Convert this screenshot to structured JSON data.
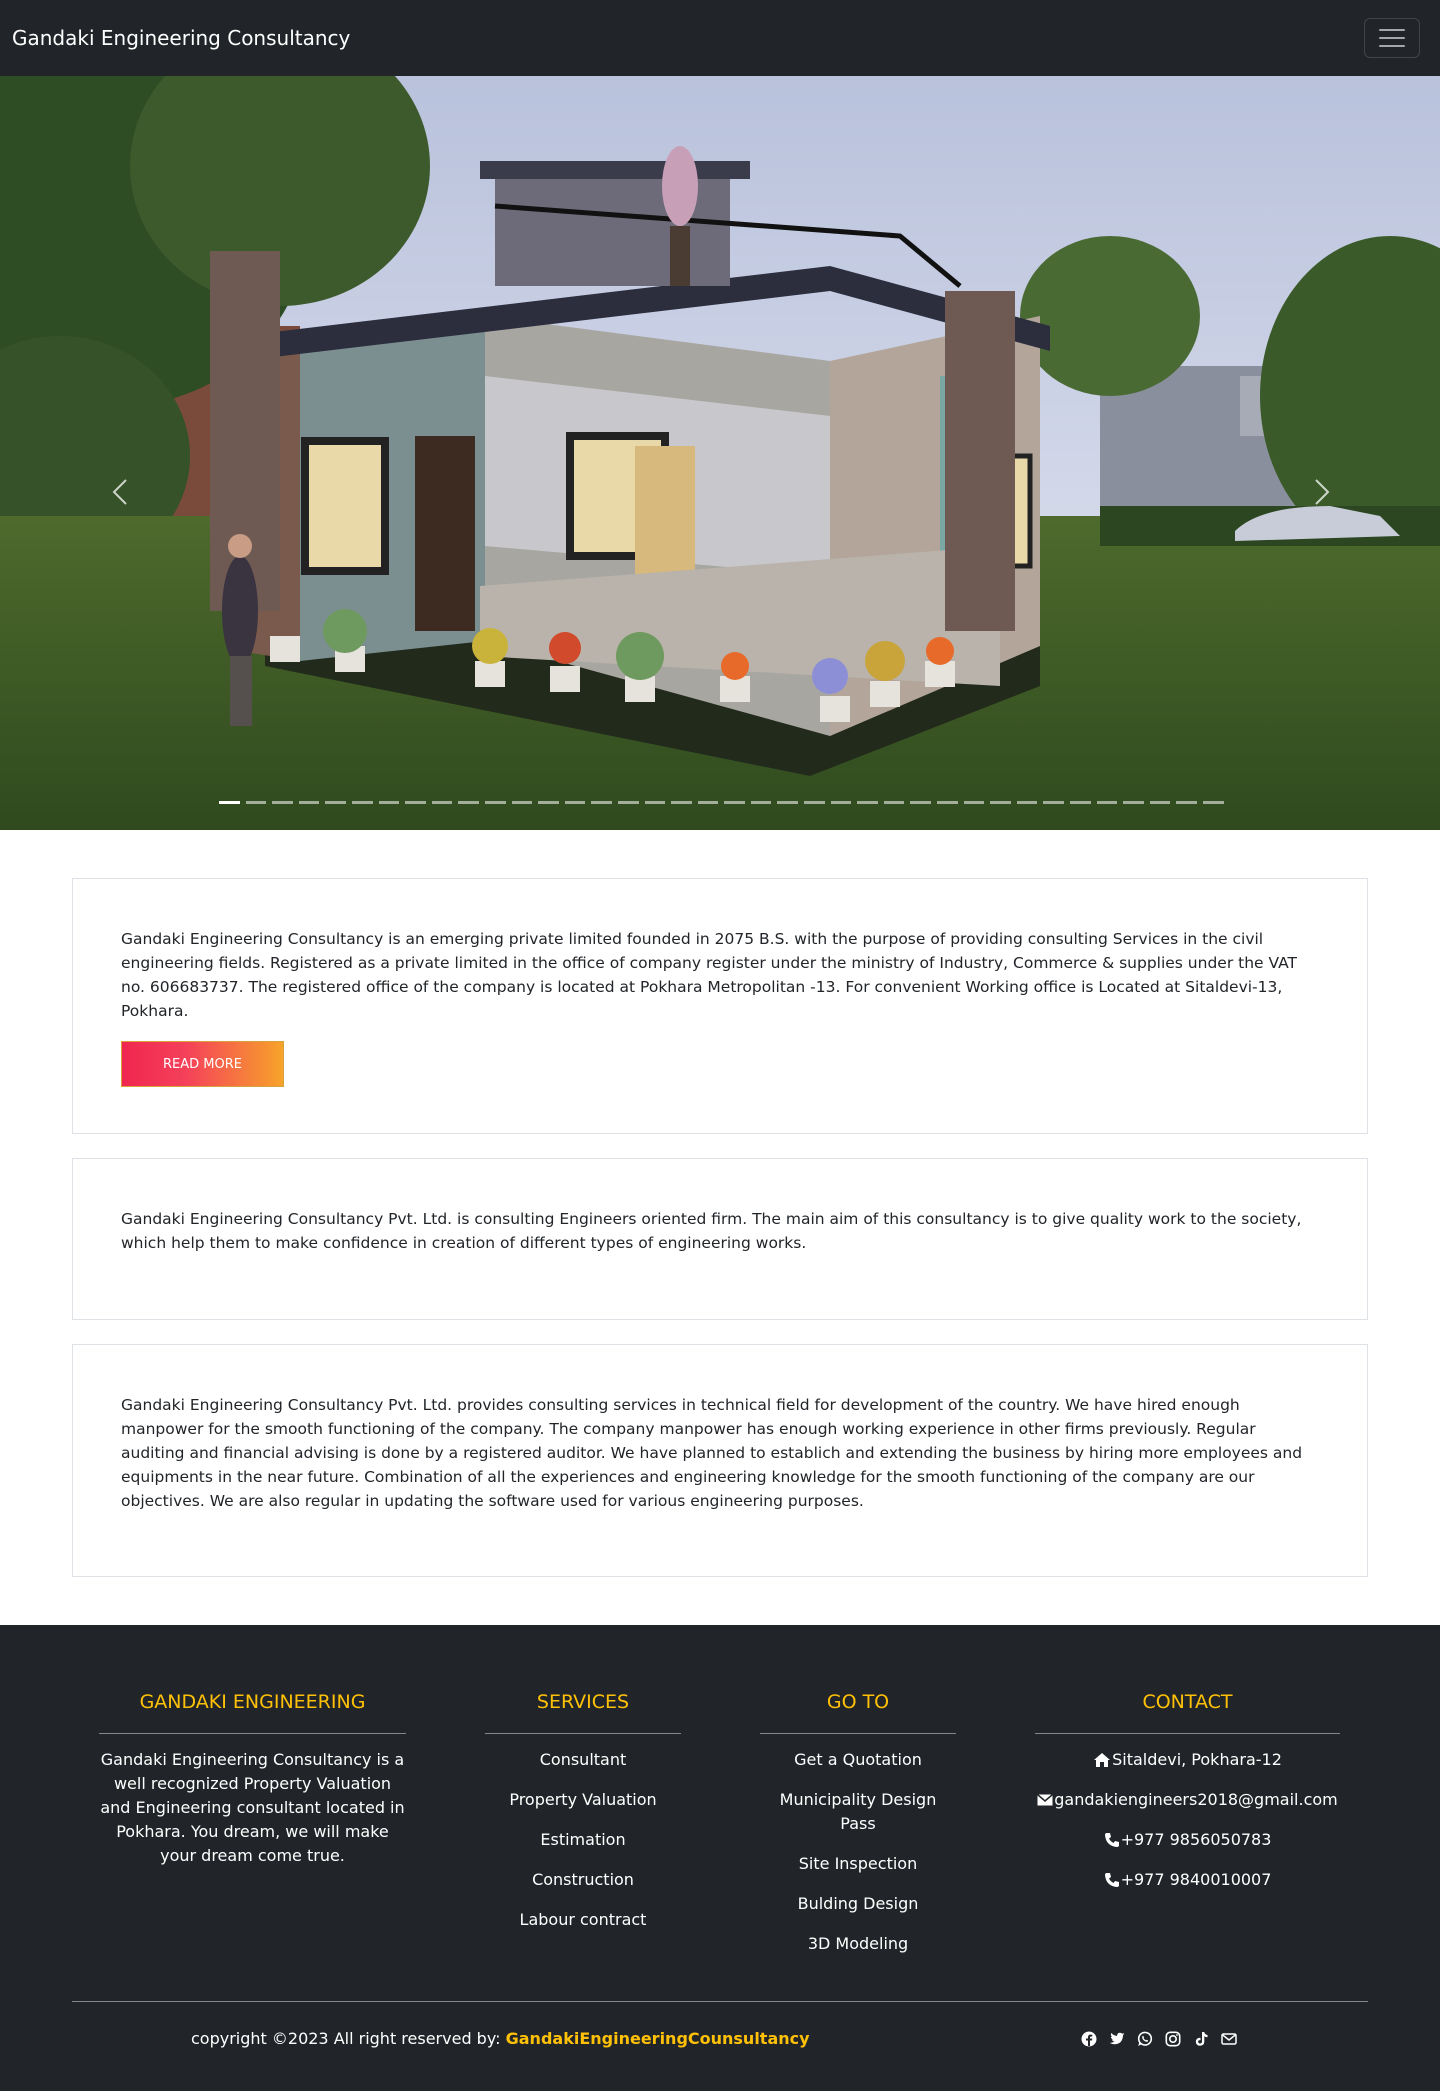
{
  "navbar": {
    "brand": "Gandaki Engineering Consultancy",
    "toggle_icon": "hamburger-menu-icon"
  },
  "carousel": {
    "slide_count": 38,
    "active_index": 0,
    "prev_icon": "chevron-left-icon",
    "next_icon": "chevron-right-icon"
  },
  "cards": [
    {
      "text": "Gandaki Engineering Consultancy is an emerging private limited founded in 2075 B.S. with the purpose of providing consulting Services in the civil engineering fields. Registered as a private limited in the office of company register under the ministry of Industry, Commerce & supplies under the VAT no. 606683737. The registered office of the company is located at Pokhara Metropolitan -13. For convenient Working office is Located at Sitaldevi-13, Pokhara.",
      "button": "READ MORE"
    },
    {
      "text": "Gandaki Engineering Consultancy Pvt. Ltd. is consulting Engineers oriented firm. The main aim of this consultancy is to give quality work to the society, which help them to make confidence in creation of different types of engineering works."
    },
    {
      "text": "Gandaki Engineering Consultancy Pvt. Ltd. provides consulting services in technical field for development of the country. We have hired enough manpower for the smooth functioning of the company. The company manpower has enough working experience in other firms previously. Regular auditing and financial advising is done by a registered auditor. We have planned to establich and extending the business by hiring more employees and equipments in the near future. Combination of all the experiences and engineering knowledge for the smooth functioning of the company are our objectives. We are also regular in updating the software used for various engineering purposes."
    }
  ],
  "footer": {
    "about": {
      "title": "GANDAKI ENGINEERING",
      "text": "Gandaki Engineering Consultancy is a well recognized Property Valuation and Engineering consultant located in Pokhara. You dream, we will make your dream come true."
    },
    "services": {
      "title": "SERVICES",
      "items": [
        "Consultant",
        "Property Valuation",
        "Estimation",
        "Construction",
        "Labour contract"
      ]
    },
    "goto": {
      "title": "GO TO",
      "items": [
        "Get a Quotation",
        "Municipality Design Pass",
        "Site Inspection",
        "Bulding Design",
        "3D Modeling"
      ]
    },
    "contact": {
      "title": "CONTACT",
      "address": "Sitaldevi, Pokhara-12",
      "email": "gandakiengineers2018@gmail.com",
      "phone1": "+977 9856050783",
      "phone2": "+977 9840010007",
      "icons": [
        "home-icon",
        "envelope-icon",
        "phone-icon",
        "phone-icon"
      ]
    },
    "copyright_prefix": "copyright ©2023 All right reserved by:",
    "copyright_brand": "GandakiEngineeringCounsultancy",
    "socials": [
      "facebook-icon",
      "twitter-icon",
      "whatsapp-icon",
      "instagram-icon",
      "tiktok-icon",
      "envelope-icon"
    ],
    "accent_color": "#ffc107"
  }
}
